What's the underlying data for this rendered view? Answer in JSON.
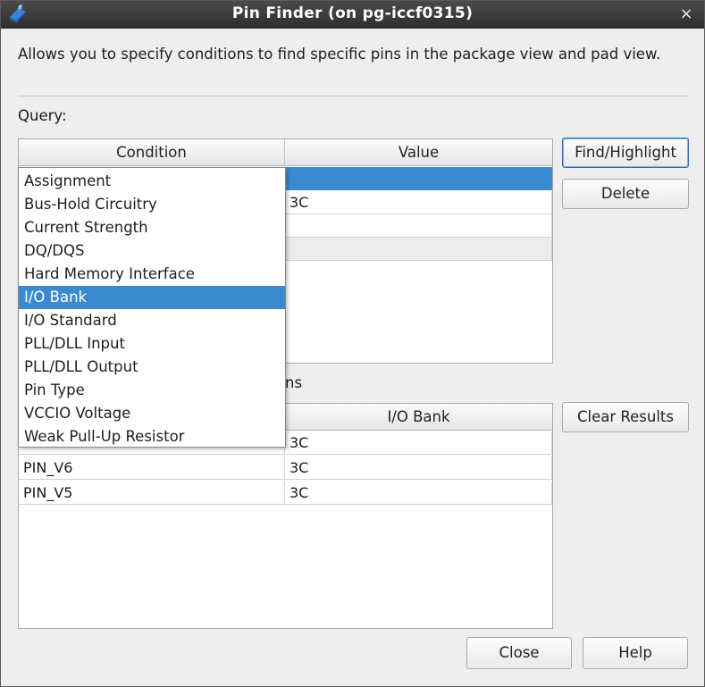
{
  "window": {
    "title": "Pin Finder (on pg-iccf0315)",
    "close_glyph": "×"
  },
  "description": "Allows you to specify conditions to find specific pins in the package view and pad view.",
  "query": {
    "label": "Query:",
    "columns": [
      "Condition",
      "Value"
    ],
    "rows": [
      {
        "condition": "",
        "value": "",
        "selected": true
      },
      {
        "condition": "",
        "value": "3C"
      },
      {
        "condition": "",
        "value": ""
      },
      {
        "condition": "",
        "value": ""
      }
    ]
  },
  "buttons": {
    "find_highlight": "Find/Highlight",
    "delete": "Delete",
    "clear_results": "Clear Results",
    "close": "Close",
    "help": "Help"
  },
  "matching_label_fragment": "ns",
  "results": {
    "columns": [
      "",
      "I/O Bank"
    ],
    "rows": [
      {
        "pin": "",
        "bank": "3C"
      },
      {
        "pin": "PIN_V6",
        "bank": "3C"
      },
      {
        "pin": "PIN_V5",
        "bank": "3C"
      }
    ]
  },
  "dropdown": {
    "selected": "I/O Bank",
    "options": [
      "Assignment",
      "Bus-Hold Circuitry",
      "Current Strength",
      "DQ/DQS",
      "Hard Memory Interface",
      "I/O Bank",
      "I/O Standard",
      "PLL/DLL Input",
      "PLL/DLL Output",
      "Pin Type",
      "VCCIO Voltage",
      "Weak Pull-Up Resistor"
    ]
  },
  "colors": {
    "selection": "#3b8ad0",
    "titlebar": "#333333",
    "dialog_bg": "#eeeeee"
  },
  "icons": {
    "app": "quartus-app-icon",
    "close": "close-icon"
  }
}
